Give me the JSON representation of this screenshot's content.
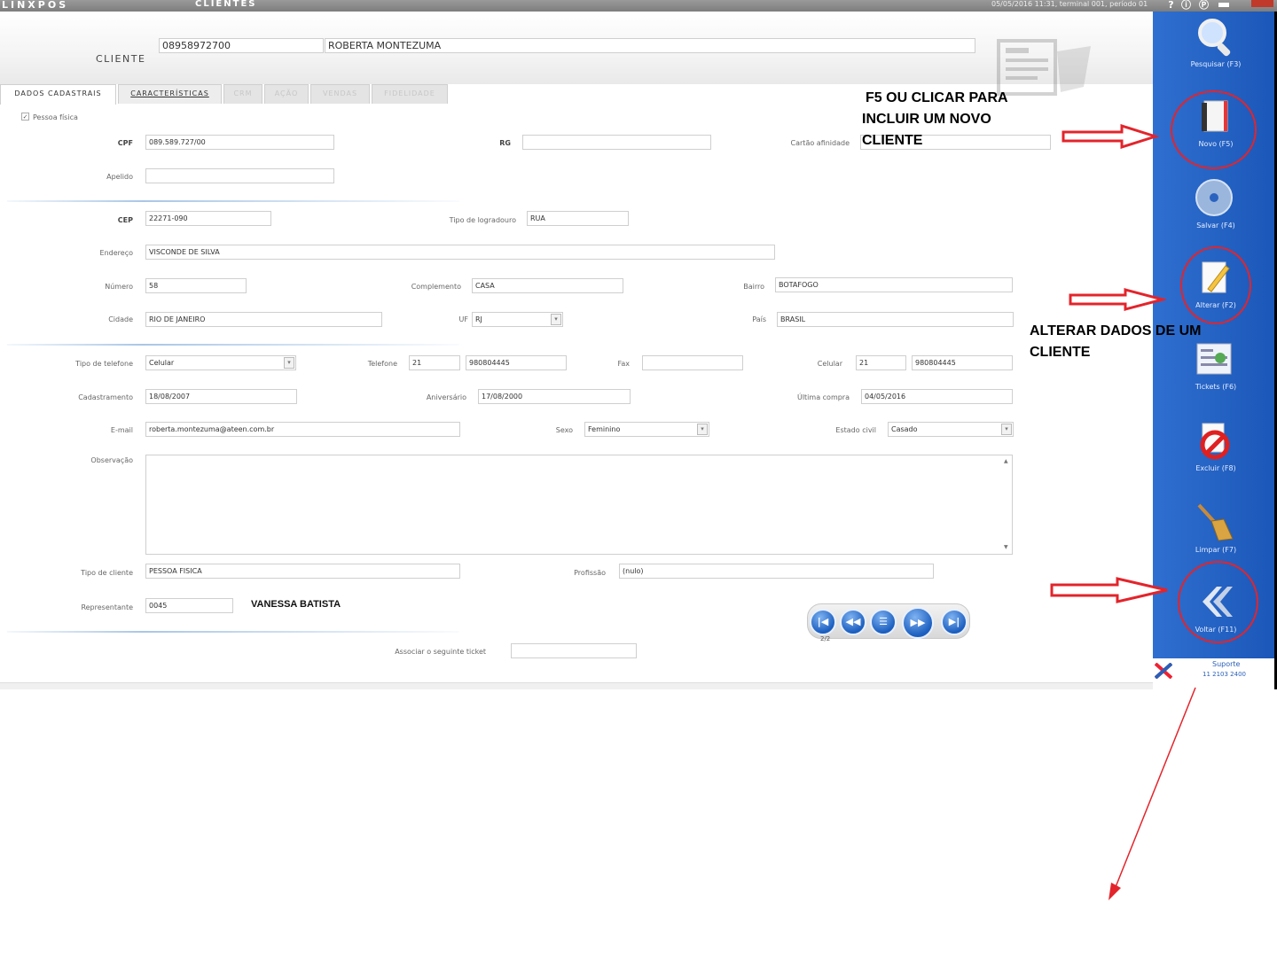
{
  "titlebar": {
    "app_name": "LINXPOS",
    "screen_name": "CLIENTES",
    "status": "05/05/2016 11:31, terminal 001, período 01",
    "help_glyph": "?",
    "info_glyph": "ⓘ",
    "p_glyph": "Ⓟ"
  },
  "header": {
    "cliente_label": "CLIENTE",
    "cliente_code": "08958972700",
    "cliente_name": "ROBERTA MONTEZUMA"
  },
  "tabs": [
    {
      "label": "DADOS CADASTRAIS"
    },
    {
      "label": "CARACTERÍSTICAS"
    },
    {
      "label": "CRM"
    },
    {
      "label": "AÇÃO"
    },
    {
      "label": "VENDAS"
    },
    {
      "label": "FIDELIDADE"
    }
  ],
  "form": {
    "pessoa_fisica_label": "Pessoa física",
    "pessoa_fisica_checked": true,
    "cpf_label": "CPF",
    "cpf": "089.589.727/00",
    "rg_label": "RG",
    "rg": "",
    "cartao_label": "Cartão afinidade",
    "cartao": "",
    "apelido_label": "Apelido",
    "apelido": "",
    "cep_label": "CEP",
    "cep": "22271-090",
    "tipo_logradouro_label": "Tipo de logradouro",
    "tipo_logradouro": "RUA",
    "endereco_label": "Endereço",
    "endereco": "VISCONDE DE SILVA",
    "numero_label": "Número",
    "numero": "58",
    "complemento_label": "Complemento",
    "complemento": "CASA",
    "bairro_label": "Bairro",
    "bairro": "BOTAFOGO",
    "cidade_label": "Cidade",
    "cidade": "RIO DE JANEIRO",
    "uf_label": "UF",
    "uf": "RJ",
    "pais_label": "País",
    "pais": "BRASIL",
    "tipo_telefone_label": "Tipo de telefone",
    "tipo_telefone": "Celular",
    "telefone_label": "Telefone",
    "telefone_ddd": "21",
    "telefone": "980804445",
    "fax_label": "Fax",
    "fax": "",
    "celular_label": "Celular",
    "celular_ddd": "21",
    "celular": "980804445",
    "cadastramento_label": "Cadastramento",
    "cadastramento": "18/08/2007",
    "aniversario_label": "Aniversário",
    "aniversario": "17/08/2000",
    "ultima_compra_label": "Última compra",
    "ultima_compra": "04/05/2016",
    "email_label": "E-mail",
    "email": "roberta.montezuma@ateen.com.br",
    "sexo_label": "Sexo",
    "sexo": "Feminino",
    "estado_civil_label": "Estado civil",
    "estado_civil": "Casado",
    "observacao_label": "Observação",
    "observacao": "",
    "tipo_cliente_label": "Tipo de cliente",
    "tipo_cliente": "PESSOA FISICA",
    "profissao_label": "Profissão",
    "profissao": "(nulo)",
    "representante_label": "Representante",
    "representante": "0045",
    "representante_name": "VANESSA BATISTA",
    "ticket_label": "Associar o seguinte ticket",
    "ticket": ""
  },
  "navigation": {
    "record_count": "2/2",
    "first_glyph": "|◀",
    "prev_glyph": "◀◀",
    "list_glyph": "☰",
    "next_glyph": "▶▶",
    "last_glyph": "▶|"
  },
  "sidebar": {
    "pesquisar": "Pesquisar (F3)",
    "novo": "Novo (F5)",
    "salvar": "Salvar (F4)",
    "alterar": "Alterar (F2)",
    "tickets": "Tickets (F6)",
    "excluir": "Excluir (F8)",
    "limpar": "Limpar (F7)",
    "voltar": "Voltar (F11)",
    "support_label": "Suporte",
    "support_phone": "11 2103 2400"
  },
  "annotations": {
    "novo_line1": "F5 OU CLICAR PARA",
    "novo_line2": "INCLUIR UM NOVO",
    "novo_line3": "CLIENTE",
    "alterar_line1": "ALTERAR DADOS DE UM",
    "alterar_line2": "CLIENTE",
    "highlight_color": "#e3242b"
  }
}
